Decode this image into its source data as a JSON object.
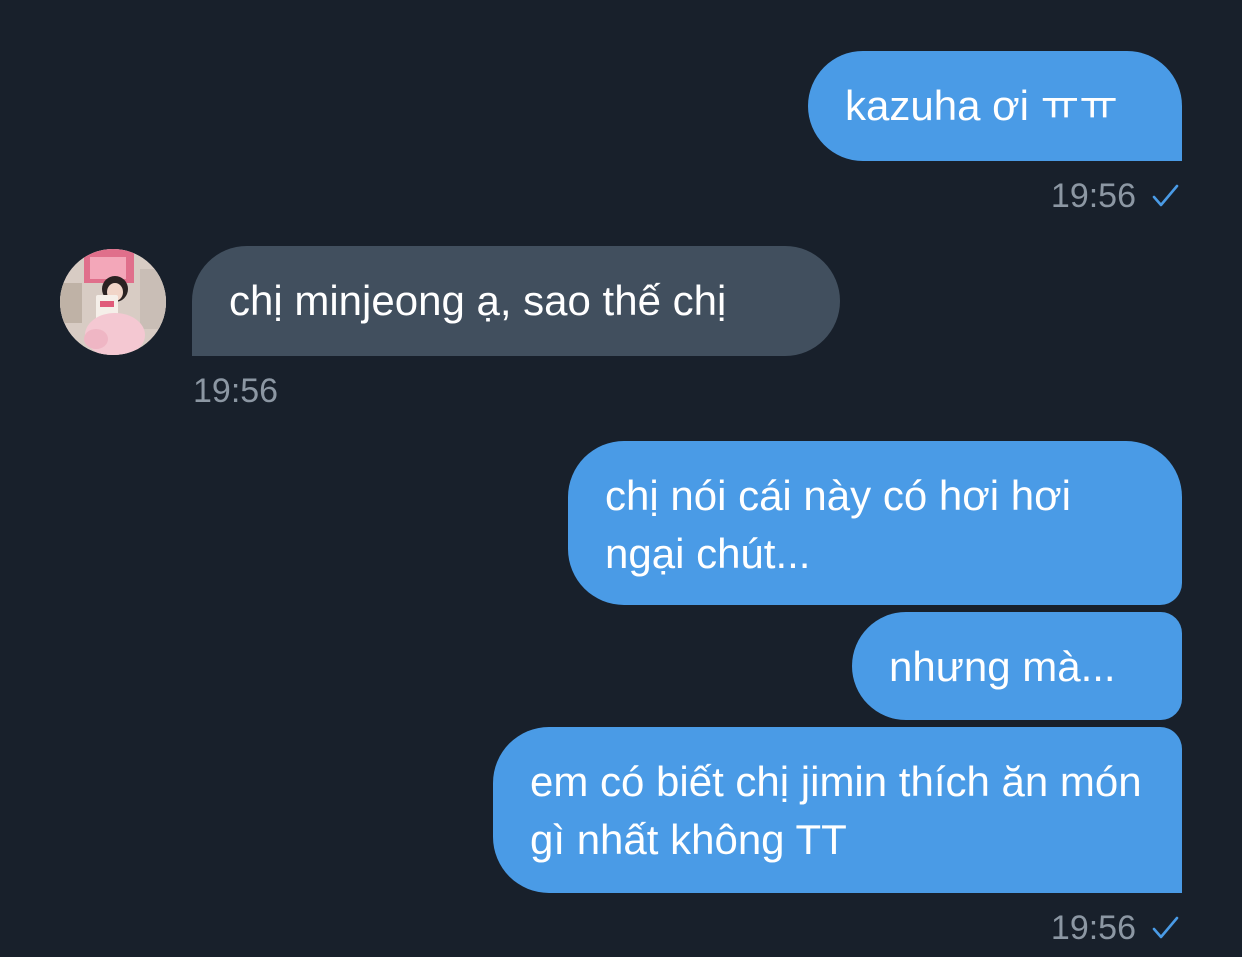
{
  "messages": [
    {
      "direction": "outgoing",
      "text": "kazuha ơi ㅠㅠ"
    },
    {
      "direction": "incoming",
      "text": "chị minjeong ạ, sao thế chị"
    },
    {
      "direction": "outgoing",
      "text": "chị nói cái này có hơi hơi ngại chút..."
    },
    {
      "direction": "outgoing",
      "text": "nhưng mà..."
    },
    {
      "direction": "outgoing",
      "text": "em có biết chị jimin thích ăn món gì nhất không TT"
    }
  ],
  "timestamps": {
    "first_outgoing": "19:56",
    "incoming": "19:56",
    "last_outgoing": "19:56"
  },
  "icons": {
    "read_receipt": "check-icon",
    "contact_avatar": "avatar"
  },
  "colors": {
    "background": "#18202b",
    "outgoing_bubble": "#4a9be6",
    "incoming_bubble": "#414f5e",
    "timestamp": "#8c97a3",
    "check": "#4a9be6"
  }
}
